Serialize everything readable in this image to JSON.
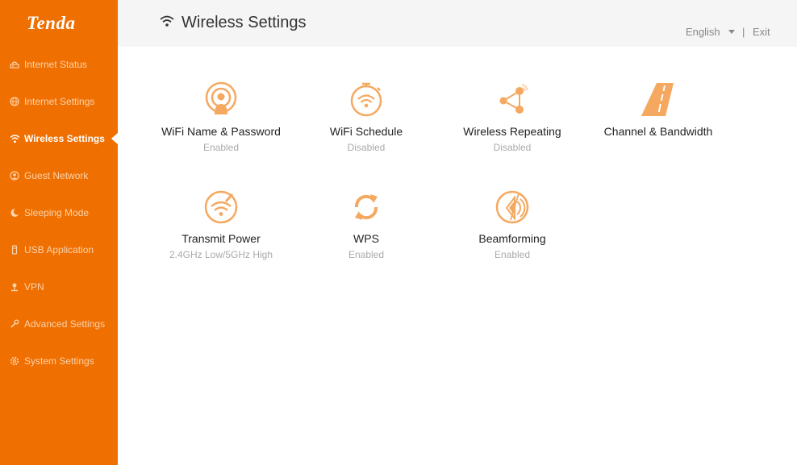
{
  "brand": {
    "logo": "Tenda",
    "accent": "#ef6f00",
    "icon_color": "#f5a85f"
  },
  "sidebar": {
    "items": [
      {
        "label": "Internet Status",
        "icon": "router-icon",
        "active": false
      },
      {
        "label": "Internet Settings",
        "icon": "globe-icon",
        "active": false
      },
      {
        "label": "Wireless Settings",
        "icon": "wifi-icon",
        "active": true
      },
      {
        "label": "Guest Network",
        "icon": "guest-icon",
        "active": false
      },
      {
        "label": "Sleeping Mode",
        "icon": "moon-icon",
        "active": false
      },
      {
        "label": "USB Application",
        "icon": "usb-icon",
        "active": false
      },
      {
        "label": "VPN",
        "icon": "vpn-icon",
        "active": false
      },
      {
        "label": "Advanced Settings",
        "icon": "wrench-icon",
        "active": false
      },
      {
        "label": "System Settings",
        "icon": "gear-icon",
        "active": false
      }
    ]
  },
  "header": {
    "title": "Wireless Settings",
    "title_icon": "wifi-icon",
    "language": "English",
    "separator": "|",
    "exit_label": "Exit"
  },
  "tiles": [
    {
      "name": "WiFi Name & Password",
      "status": "Enabled",
      "icon": "wifi-password-icon"
    },
    {
      "name": "WiFi Schedule",
      "status": "Disabled",
      "icon": "wifi-schedule-icon"
    },
    {
      "name": "Wireless Repeating",
      "status": "Disabled",
      "icon": "repeating-icon"
    },
    {
      "name": "Channel & Bandwidth",
      "status": "",
      "icon": "road-icon"
    },
    {
      "name": "Transmit Power",
      "status": "2.4GHz Low/5GHz High",
      "icon": "transmit-power-icon"
    },
    {
      "name": "WPS",
      "status": "Enabled",
      "icon": "wps-icon"
    },
    {
      "name": "Beamforming",
      "status": "Enabled",
      "icon": "beamforming-icon"
    }
  ]
}
